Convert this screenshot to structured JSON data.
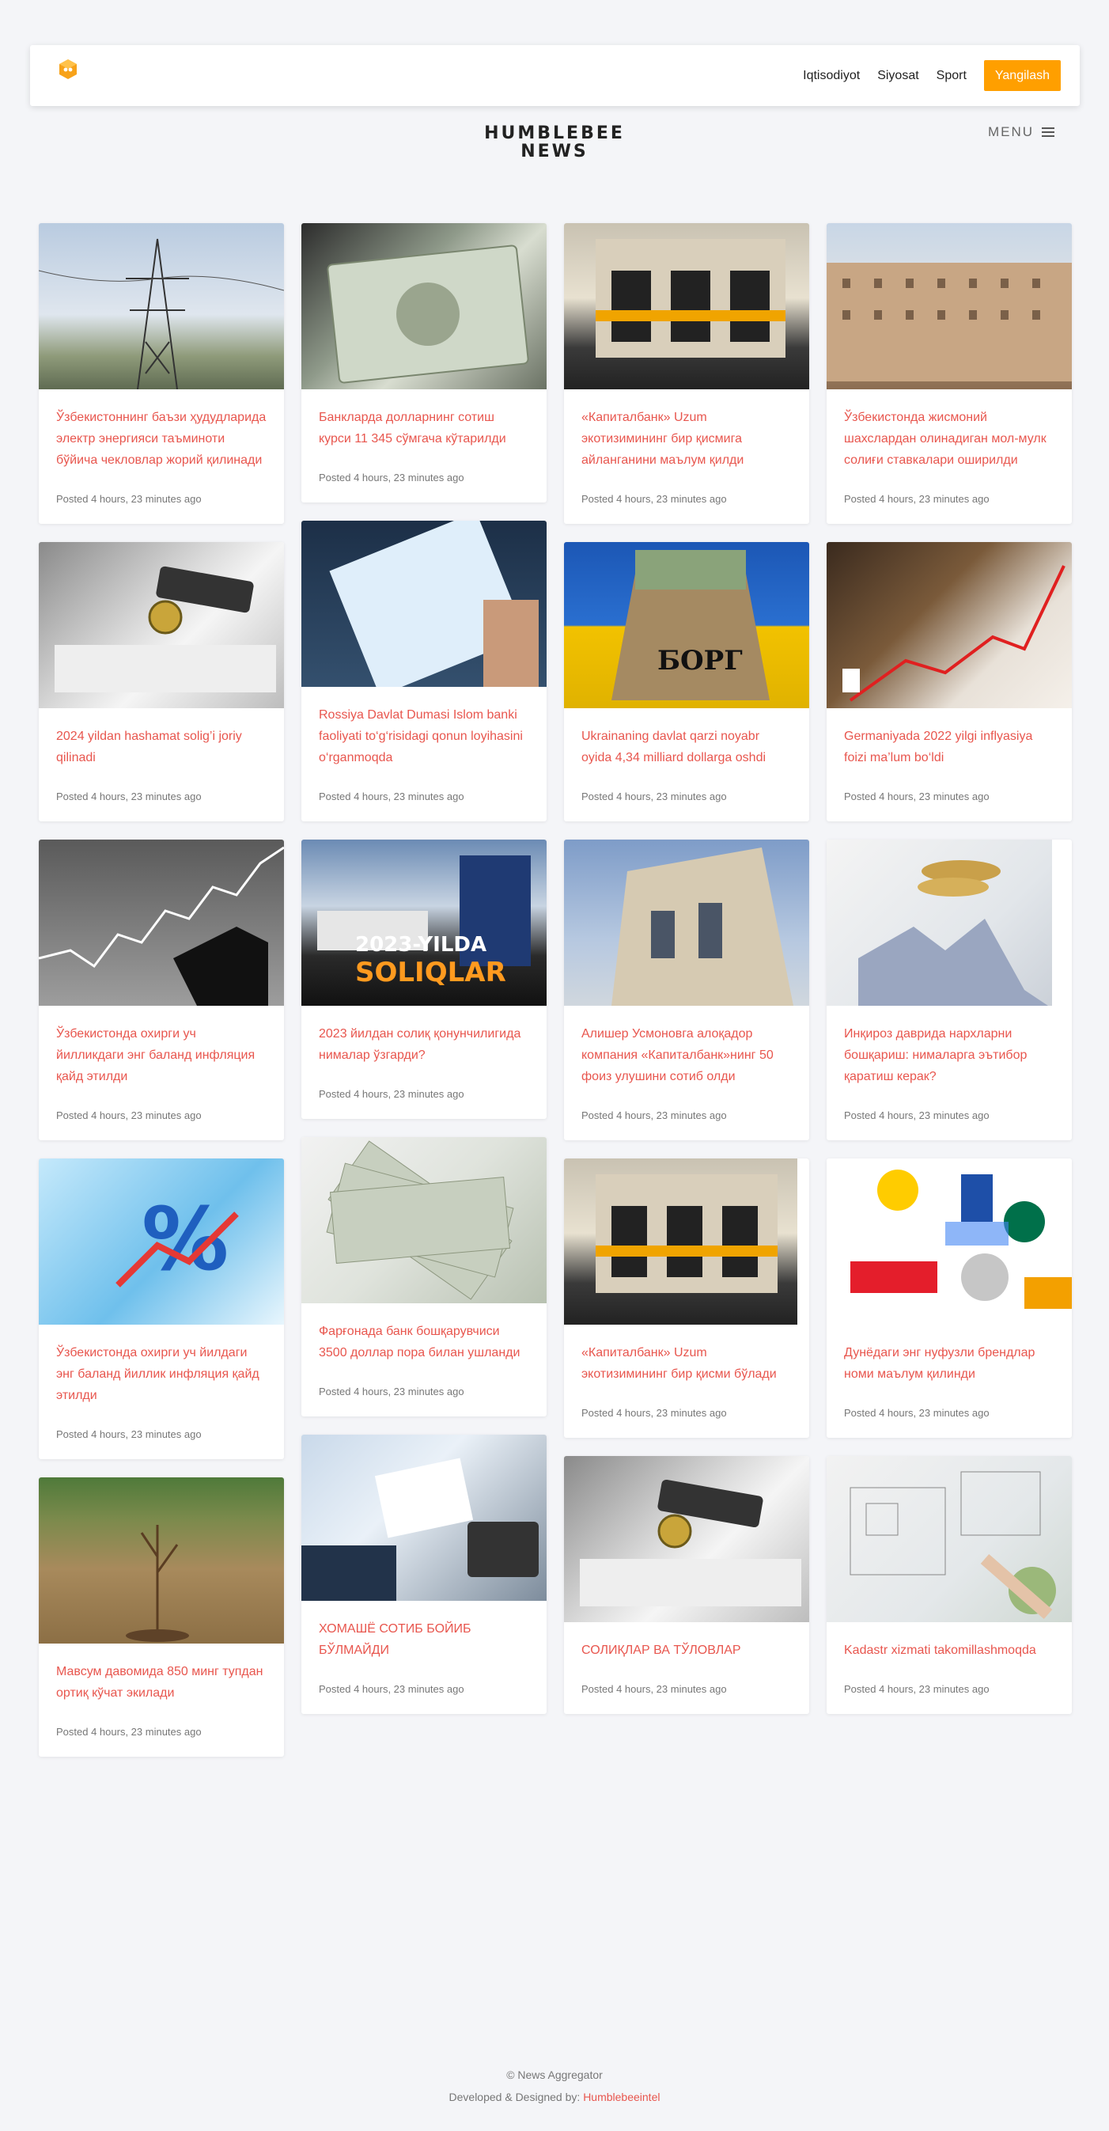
{
  "nav": {
    "logo_name": "humblebee-logo",
    "links": [
      "Iqtisodiyot",
      "Siyosat",
      "Sport"
    ],
    "cta": "Yangilash"
  },
  "brand": {
    "line1": "HUMBLEBEE",
    "line2": "NEWS",
    "menu_label": "MENU"
  },
  "posted": "Posted 4 hours, 23 minutes ago",
  "columns": [
    [
      {
        "title": "Ўзбекистоннинг баъзи ҳудудларида электр энергияси таъминоти бўйича чекловлар жорий қилинади"
      },
      {
        "title": "2024 yildan hashamat solig’i joriy qilinadi"
      },
      {
        "title": "Ўзбекистонда охирги уч йилликдаги энг баланд инфляция қайд этилди"
      },
      {
        "title": "Ўзбекистонда охирги уч йилдаги энг баланд йиллик инфляция қайд этилди"
      },
      {
        "title": "Мавсум давомида 850 минг тупдан ортиқ кўчат экилади"
      }
    ],
    [
      {
        "title": "Банкларда долларнинг сотиш курси 11 345 сўмгача кўтарилди"
      },
      {
        "title": "Rossiya Davlat Dumasi Islom banki faoliyati to‘g‘risidagi qonun loyihasini o‘rganmoqda"
      },
      {
        "title": "2023 йилдан солиқ қонунчилигида нималар ўзгарди?",
        "thumb_text_1": "2023-YILDA",
        "thumb_text_2": "SOLIQLAR"
      },
      {
        "title": "Фарғонада банк бошқарувчиси 3500 доллар пора билан ушланди"
      },
      {
        "title": "ХОМАШЁ СОТИБ БОЙИБ БЎЛМАЙДИ"
      }
    ],
    [
      {
        "title": "«Капиталбанк» Uzum экотизимининг бир қисмига айланганини маълум қилди"
      },
      {
        "title": "Ukrainaning davlat qarzi noyabr oyida 4,34 milliard dollarga oshdi",
        "thumb_text_1": "БОРГ"
      },
      {
        "title": "Алишер Усмоновга алоқадор компания «Капиталбанк»нинг 50 фоиз улушини сотиб олди"
      },
      {
        "title": "«Капиталбанк» Uzum экотизимининг бир қисми бўлади"
      },
      {
        "title": "СОЛИҚЛАР ВА ТЎЛОВЛАР"
      }
    ],
    [
      {
        "title": "Ўзбекистонда жисмоний шахслардан олинадиган мол-мулк солиғи ставкалари оширилди"
      },
      {
        "title": "Germaniyada 2022 yilgi inflyasiya foizi ma’lum bo‘ldi"
      },
      {
        "title": "Инқироз даврида нархларни бошқариш: нималарга эътибор қаратиш керак?"
      },
      {
        "title": "Дунёдаги энг нуфузли брендлар номи маълум қилинди"
      },
      {
        "title": "Kadastr xizmati takomillashmoqda"
      }
    ]
  ],
  "footer": {
    "copyright": "© News Aggregator",
    "credit_prefix": "Developed & Designed by: ",
    "credit_link": "Humblebeeintel"
  }
}
